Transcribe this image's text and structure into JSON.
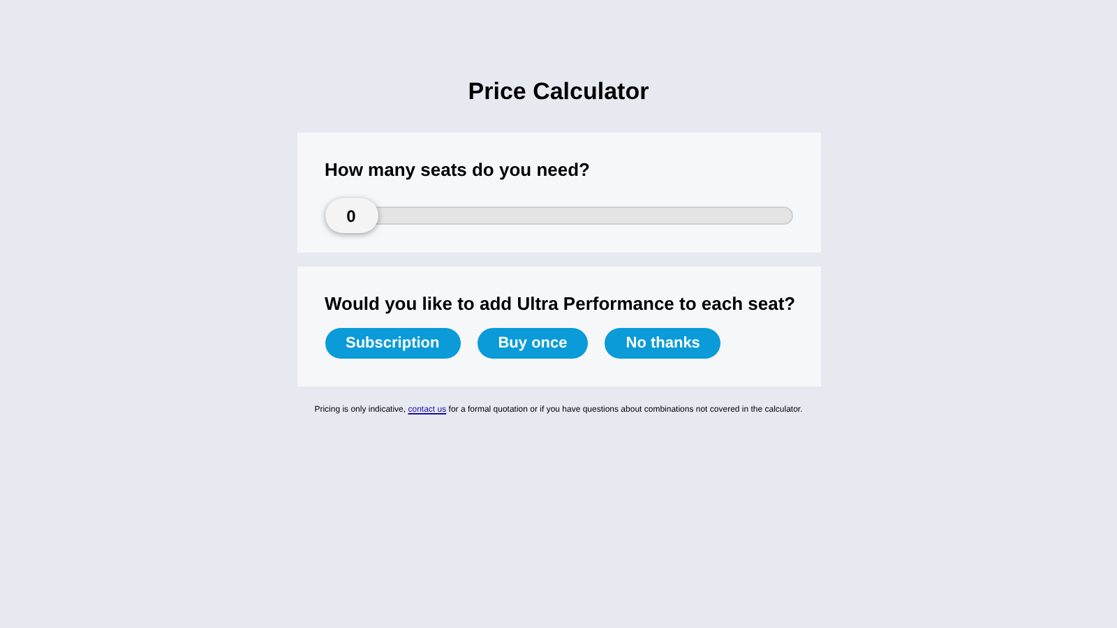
{
  "title": "Price Calculator",
  "seats": {
    "question": "How many seats do you need?",
    "slider": {
      "level": 0,
      "value": "0"
    }
  },
  "addon": {
    "question": "Would you like to add Ultra Performance to each seat?",
    "buttons": [
      "Subscription",
      "Buy once",
      "No thanks"
    ]
  },
  "footer": {
    "before": "Pricing is only indicative,",
    "link": "contact us",
    "after": "for a formal quotation or if you have questions about combinations not covered in the calculator."
  }
}
